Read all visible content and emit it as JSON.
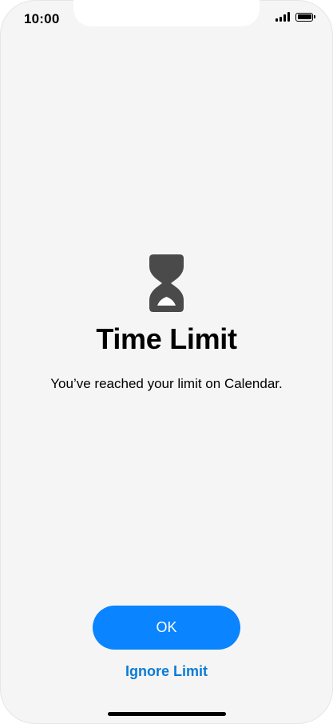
{
  "status_bar": {
    "time": "10:00",
    "icons": [
      "signal-icon",
      "battery-icon"
    ]
  },
  "alert": {
    "icon": "hourglass-icon",
    "title": "Time Limit",
    "message": "You’ve reached your limit on Calendar."
  },
  "actions": {
    "ok_label": "OK",
    "ignore_label": "Ignore Limit"
  },
  "colors": {
    "background": "#f5f5f5",
    "accent": "#0a84ff",
    "link": "#0a7bd6",
    "icon": "#4a4a4a"
  }
}
